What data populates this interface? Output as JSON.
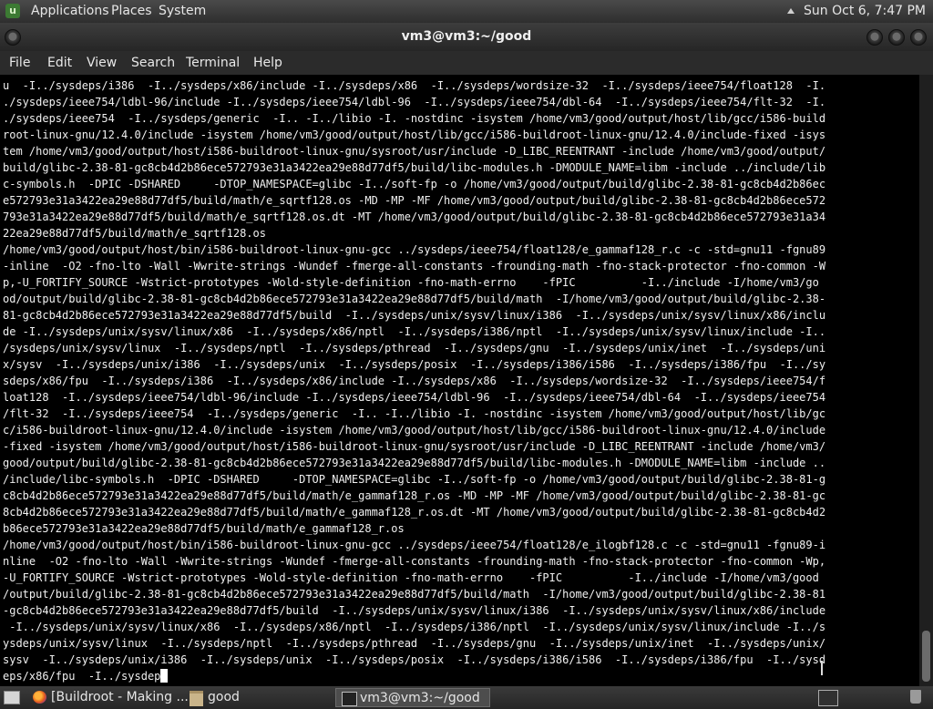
{
  "top_panel": {
    "logo_glyph": "u",
    "menus": [
      "Applications",
      "Places",
      "System"
    ],
    "clock": "Sun Oct  6,  7:47 PM"
  },
  "window": {
    "title": "vm3@vm3:~/good"
  },
  "menubar": {
    "items": [
      "File",
      "Edit",
      "View",
      "Search",
      "Terminal",
      "Help"
    ]
  },
  "terminal": {
    "lines": [
      "u  -I../sysdeps/i386  -I../sysdeps/x86/include -I../sysdeps/x86  -I../sysdeps/wordsize-32  -I../sysdeps/ieee754/float128  -I.",
      "./sysdeps/ieee754/ldbl-96/include -I../sysdeps/ieee754/ldbl-96  -I../sysdeps/ieee754/dbl-64  -I../sysdeps/ieee754/flt-32  -I.",
      "./sysdeps/ieee754  -I../sysdeps/generic  -I.. -I../libio -I. -nostdinc -isystem /home/vm3/good/output/host/lib/gcc/i586-build",
      "root-linux-gnu/12.4.0/include -isystem /home/vm3/good/output/host/lib/gcc/i586-buildroot-linux-gnu/12.4.0/include-fixed -isys",
      "tem /home/vm3/good/output/host/i586-buildroot-linux-gnu/sysroot/usr/include -D_LIBC_REENTRANT -include /home/vm3/good/output/",
      "build/glibc-2.38-81-gc8cb4d2b86ece572793e31a3422ea29e88d77df5/build/libc-modules.h -DMODULE_NAME=libm -include ../include/lib",
      "c-symbols.h  -DPIC -DSHARED     -DTOP_NAMESPACE=glibc -I../soft-fp -o /home/vm3/good/output/build/glibc-2.38-81-gc8cb4d2b86ec",
      "e572793e31a3422ea29e88d77df5/build/math/e_sqrtf128.os -MD -MP -MF /home/vm3/good/output/build/glibc-2.38-81-gc8cb4d2b86ece572",
      "793e31a3422ea29e88d77df5/build/math/e_sqrtf128.os.dt -MT /home/vm3/good/output/build/glibc-2.38-81-gc8cb4d2b86ece572793e31a34",
      "22ea29e88d77df5/build/math/e_sqrtf128.os",
      "/home/vm3/good/output/host/bin/i586-buildroot-linux-gnu-gcc ../sysdeps/ieee754/float128/e_gammaf128_r.c -c -std=gnu11 -fgnu89",
      "-inline  -O2 -fno-lto -Wall -Wwrite-strings -Wundef -fmerge-all-constants -frounding-math -fno-stack-protector -fno-common -W",
      "p,-U_FORTIFY_SOURCE -Wstrict-prototypes -Wold-style-definition -fno-math-errno    -fPIC          -I../include -I/home/vm3/go",
      "od/output/build/glibc-2.38-81-gc8cb4d2b86ece572793e31a3422ea29e88d77df5/build/math  -I/home/vm3/good/output/build/glibc-2.38-",
      "81-gc8cb4d2b86ece572793e31a3422ea29e88d77df5/build  -I../sysdeps/unix/sysv/linux/i386  -I../sysdeps/unix/sysv/linux/x86/inclu",
      "de -I../sysdeps/unix/sysv/linux/x86  -I../sysdeps/x86/nptl  -I../sysdeps/i386/nptl  -I../sysdeps/unix/sysv/linux/include -I..",
      "/sysdeps/unix/sysv/linux  -I../sysdeps/nptl  -I../sysdeps/pthread  -I../sysdeps/gnu  -I../sysdeps/unix/inet  -I../sysdeps/uni",
      "x/sysv  -I../sysdeps/unix/i386  -I../sysdeps/unix  -I../sysdeps/posix  -I../sysdeps/i386/i586  -I../sysdeps/i386/fpu  -I../sy",
      "sdeps/x86/fpu  -I../sysdeps/i386  -I../sysdeps/x86/include -I../sysdeps/x86  -I../sysdeps/wordsize-32  -I../sysdeps/ieee754/f",
      "loat128  -I../sysdeps/ieee754/ldbl-96/include -I../sysdeps/ieee754/ldbl-96  -I../sysdeps/ieee754/dbl-64  -I../sysdeps/ieee754",
      "/flt-32  -I../sysdeps/ieee754  -I../sysdeps/generic  -I.. -I../libio -I. -nostdinc -isystem /home/vm3/good/output/host/lib/gc",
      "c/i586-buildroot-linux-gnu/12.4.0/include -isystem /home/vm3/good/output/host/lib/gcc/i586-buildroot-linux-gnu/12.4.0/include",
      "-fixed -isystem /home/vm3/good/output/host/i586-buildroot-linux-gnu/sysroot/usr/include -D_LIBC_REENTRANT -include /home/vm3/",
      "good/output/build/glibc-2.38-81-gc8cb4d2b86ece572793e31a3422ea29e88d77df5/build/libc-modules.h -DMODULE_NAME=libm -include ..",
      "/include/libc-symbols.h  -DPIC -DSHARED     -DTOP_NAMESPACE=glibc -I../soft-fp -o /home/vm3/good/output/build/glibc-2.38-81-g",
      "c8cb4d2b86ece572793e31a3422ea29e88d77df5/build/math/e_gammaf128_r.os -MD -MP -MF /home/vm3/good/output/build/glibc-2.38-81-gc",
      "8cb4d2b86ece572793e31a3422ea29e88d77df5/build/math/e_gammaf128_r.os.dt -MT /home/vm3/good/output/build/glibc-2.38-81-gc8cb4d2",
      "b86ece572793e31a3422ea29e88d77df5/build/math/e_gammaf128_r.os",
      "/home/vm3/good/output/host/bin/i586-buildroot-linux-gnu-gcc ../sysdeps/ieee754/float128/e_ilogbf128.c -c -std=gnu11 -fgnu89-i",
      "nline  -O2 -fno-lto -Wall -Wwrite-strings -Wundef -fmerge-all-constants -frounding-math -fno-stack-protector -fno-common -Wp,",
      "-U_FORTIFY_SOURCE -Wstrict-prototypes -Wold-style-definition -fno-math-errno    -fPIC          -I../include -I/home/vm3/good",
      "/output/build/glibc-2.38-81-gc8cb4d2b86ece572793e31a3422ea29e88d77df5/build/math  -I/home/vm3/good/output/build/glibc-2.38-81",
      "-gc8cb4d2b86ece572793e31a3422ea29e88d77df5/build  -I../sysdeps/unix/sysv/linux/i386  -I../sysdeps/unix/sysv/linux/x86/include",
      " -I../sysdeps/unix/sysv/linux/x86  -I../sysdeps/x86/nptl  -I../sysdeps/i386/nptl  -I../sysdeps/unix/sysv/linux/include -I../s",
      "ysdeps/unix/sysv/linux  -I../sysdeps/nptl  -I../sysdeps/pthread  -I../sysdeps/gnu  -I../sysdeps/unix/inet  -I../sysdeps/unix/",
      "sysv  -I../sysdeps/unix/i386  -I../sysdeps/unix  -I../sysdeps/posix  -I../sysdeps/i386/i586  -I../sysdeps/i386/fpu  -I../sysd",
      "eps/x86/fpu  -I../sysdep"
    ]
  },
  "taskbar": {
    "items": [
      {
        "label": "[Buildroot - Making ...",
        "icon": "firefox-icon"
      },
      {
        "label": "good",
        "icon": "folder-icon"
      },
      {
        "label": "vm3@vm3:~/good",
        "icon": "terminal-icon"
      }
    ]
  }
}
